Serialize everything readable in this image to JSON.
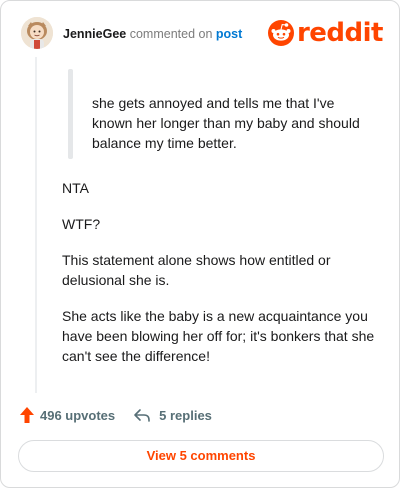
{
  "header": {
    "username": "JennieGee",
    "commented_text": "commented on",
    "post_link": "post",
    "logo_text": "reddit"
  },
  "comment": {
    "quote": "she gets annoyed and tells me that I've known her longer than my baby and should balance my time better.",
    "paragraphs": [
      "NTA",
      "WTF?",
      "This statement alone shows how entitled or delusional she is.",
      "She acts like the baby is a new acquaintance you have been blowing her off for; it's bonkers that she can't see the difference!"
    ]
  },
  "actions": {
    "upvotes": "496 upvotes",
    "replies": "5 replies"
  },
  "view_comments_label": "View 5 comments",
  "colors": {
    "brand": "#ff4500",
    "link": "#0079d3",
    "muted": "#576f76"
  },
  "icons": {
    "avatar": "avatar-illustration",
    "logo": "reddit-snoo-icon",
    "upvote": "upvote-arrow-icon",
    "reply": "reply-arrow-icon"
  }
}
